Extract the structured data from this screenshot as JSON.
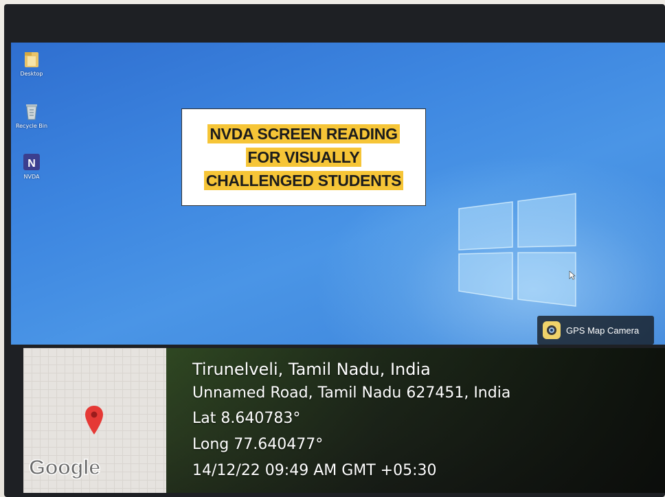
{
  "desktop": {
    "icons": [
      {
        "label": "Desktop",
        "icon": "folder-icon"
      },
      {
        "label": "Recycle Bin",
        "icon": "recycle-bin-icon"
      },
      {
        "label": "NVDA",
        "icon": "nvda-icon"
      }
    ],
    "title_card": {
      "lines": [
        "NVDA SCREEN READING",
        "FOR VISUALLY",
        "CHALLENGED STUDENTS"
      ],
      "highlight_color": "#f6c537"
    },
    "accent_color": "#3d86e0"
  },
  "gps_badge": {
    "label": "GPS Map Camera",
    "icon": "camera-icon"
  },
  "location": {
    "map_logo": "Google",
    "pin_icon": "map-pin-icon",
    "pin_color": "#e53935",
    "place": "Tirunelveli, Tamil Nadu, India",
    "address": "Unnamed Road, Tamil Nadu 627451, India",
    "lat": "Lat 8.640783°",
    "long": "Long 77.640477°",
    "timestamp": "14/12/22 09:49 AM GMT +05:30"
  }
}
